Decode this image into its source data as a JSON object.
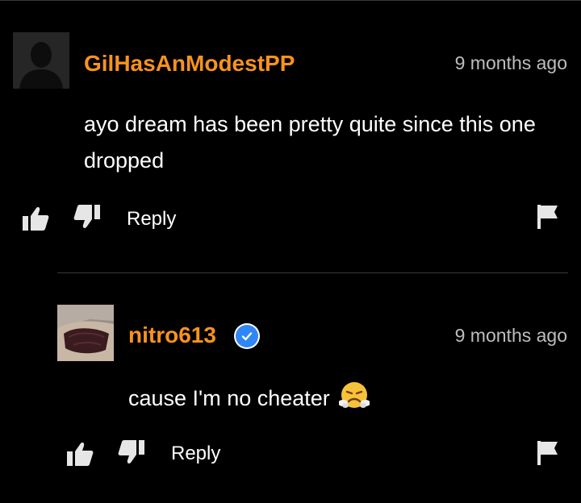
{
  "colors": {
    "background": "#000000",
    "username": "#f7931e",
    "text": "#ffffff",
    "muted": "#bdbdbd",
    "icon": "#e6e6e6",
    "divider": "#3a3a3a",
    "verified": "#2f86f6"
  },
  "comments": [
    {
      "username": "GilHasAnModestPP",
      "timestamp": "9 months ago",
      "text": "ayo dream has been pretty quite since this one dropped",
      "reply_label": "Reply",
      "avatar": "default-avatar-icon",
      "verified": false
    },
    {
      "username": "nitro613",
      "timestamp": "9 months ago",
      "text": "cause I'm no cheater",
      "emoji": "steam-from-nose-face-icon",
      "reply_label": "Reply",
      "avatar": "user-photo-avatar",
      "verified": true
    }
  ]
}
